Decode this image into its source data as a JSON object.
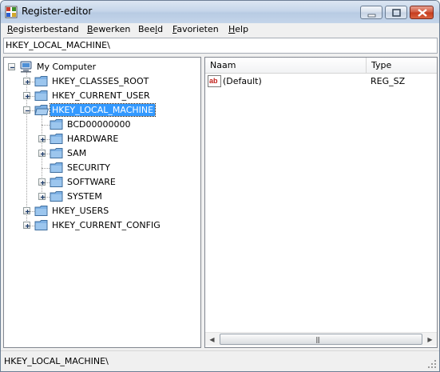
{
  "window": {
    "title": "Register-editor"
  },
  "menu": [
    {
      "label": "Registerbestand",
      "accel": "R",
      "rest": "egisterbestand"
    },
    {
      "label": "Bewerken",
      "accel": "B",
      "rest": "ewerken"
    },
    {
      "label": "Beeld",
      "pre": "Bee",
      "accel": "l",
      "rest": "d"
    },
    {
      "label": "Favorieten",
      "accel": "F",
      "rest": "avorieten"
    },
    {
      "label": "Help",
      "accel": "H",
      "rest": "elp"
    }
  ],
  "address": "HKEY_LOCAL_MACHINE\\",
  "tree": {
    "root": "My Computer",
    "hives": [
      "HKEY_CLASSES_ROOT",
      "HKEY_CURRENT_USER",
      "HKEY_LOCAL_MACHINE",
      "HKEY_USERS",
      "HKEY_CURRENT_CONFIG"
    ],
    "selected": "HKEY_LOCAL_MACHINE",
    "local_machine_children": [
      "BCD00000000",
      "HARDWARE",
      "SAM",
      "SECURITY",
      "SOFTWARE",
      "SYSTEM"
    ]
  },
  "list": {
    "columns": [
      "Naam",
      "Type"
    ],
    "rows": [
      {
        "name": "(Default)",
        "type": "REG_SZ",
        "icon": "string-value-icon"
      }
    ]
  },
  "status": "HKEY_LOCAL_MACHINE\\",
  "colors": {
    "selection": "#3399ff",
    "folder": "#7fb2e5",
    "close_button": "#c53a1c"
  }
}
